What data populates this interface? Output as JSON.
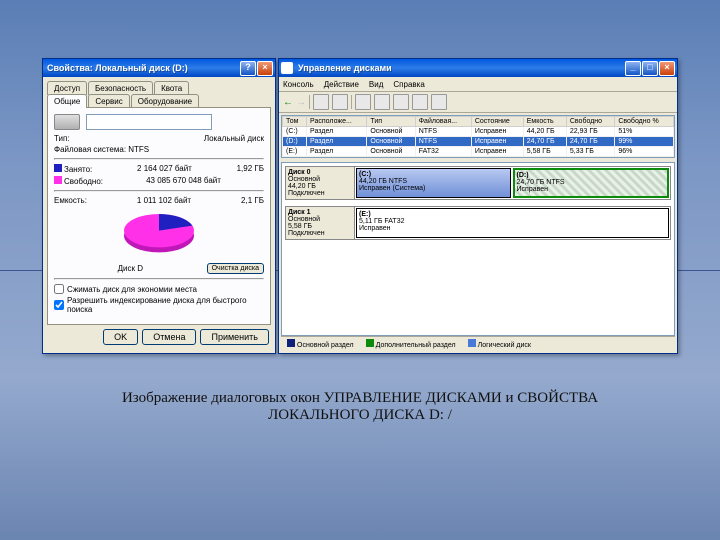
{
  "caption_line1": "Изображение диалоговых окон УПРАВЛЕНИЕ ДИСКАМИ и СВОЙСТВА",
  "caption_line2": "ЛОКАЛЬНОГО ДИСКА D: /",
  "props": {
    "title": "Свойства: Локальный диск (D:)",
    "tabs_top": [
      "Доступ",
      "Безопасность",
      "Квота"
    ],
    "tabs_bot": [
      "Общие",
      "Сервис",
      "Оборудование"
    ],
    "type_lbl": "Тип:",
    "type_val": "Локальный диск",
    "fs_lbl": "Файловая система: NTFS",
    "used_lbl": "Занято:",
    "used_bytes": "2 164 027 байт",
    "used_gb": "1,92 ГБ",
    "free_lbl": "Свободно:",
    "free_bytes": "43 085 670 048 байт",
    "free_gb": "",
    "cap_lbl": "Емкость:",
    "cap_bytes": "1 011 102 байт",
    "cap_gb": "2,1 ГБ",
    "disk_lbl": "Диск D",
    "cleanup": "Очистка диска",
    "chk1": "Сжимать диск для экономии места",
    "chk2": "Разрешить индексирование диска для быстрого поиска",
    "ok": "OK",
    "cancel": "Отмена",
    "apply": "Применить"
  },
  "mgmt": {
    "title": "Управление дисками",
    "menu": [
      "Консоль",
      "Действие",
      "Вид",
      "Справка"
    ],
    "cols": [
      "Том",
      "Расположе...",
      "Тип",
      "Файловая...",
      "Состояние",
      "Емкость",
      "Свободно",
      "Свободно %"
    ],
    "rows": [
      {
        "c": [
          "(C:)",
          "Раздел",
          "Основной",
          "NTFS",
          "Исправен",
          "44,20 ГБ",
          "22,93 ГБ",
          "51%"
        ]
      },
      {
        "c": [
          "(D:)",
          "Раздел",
          "Основной",
          "NTFS",
          "Исправен",
          "24,70 ГБ",
          "24,70 ГБ",
          "99%"
        ]
      },
      {
        "c": [
          "(E:)",
          "Раздел",
          "Основной",
          "FAT32",
          "Исправен",
          "5,58 ГБ",
          "5,33 ГБ",
          "96%"
        ]
      }
    ],
    "disk0": {
      "name": "Диск 0",
      "type": "Основной",
      "size": "44,20 ГБ",
      "status": "Подключен",
      "parts": [
        {
          "l": "(C:)",
          "s": "44,20 ГБ NTFS",
          "st": "Исправен (Система)"
        },
        {
          "l": "(D:)",
          "s": "24,70 ГБ NTFS",
          "st": "Исправен"
        }
      ]
    },
    "disk1": {
      "name": "Диск 1",
      "type": "Основной",
      "size": "5,58 ГБ",
      "status": "Подключен",
      "parts": [
        {
          "l": "(E:)",
          "s": "5,11 ГБ FAT32",
          "st": "Исправен"
        }
      ]
    },
    "leg": [
      "Основной раздел",
      "Дополнительный раздел",
      "Логический диск"
    ]
  },
  "chart_data": {
    "type": "pie",
    "title": "Диск D",
    "series": [
      {
        "name": "Занято",
        "value": 1.92,
        "color": "#2020c0"
      },
      {
        "name": "Свободно",
        "value": 24.7,
        "color": "#ff30e8"
      }
    ]
  }
}
